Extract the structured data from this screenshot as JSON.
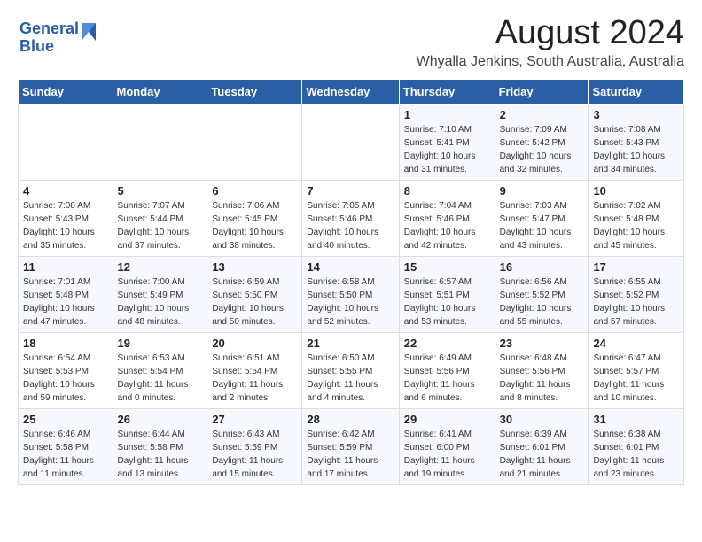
{
  "header": {
    "logo_line1": "General",
    "logo_line2": "Blue",
    "title": "August 2024",
    "subtitle": "Whyalla Jenkins, South Australia, Australia"
  },
  "days_of_week": [
    "Sunday",
    "Monday",
    "Tuesday",
    "Wednesday",
    "Thursday",
    "Friday",
    "Saturday"
  ],
  "weeks": [
    [
      {
        "day": "",
        "info": ""
      },
      {
        "day": "",
        "info": ""
      },
      {
        "day": "",
        "info": ""
      },
      {
        "day": "",
        "info": ""
      },
      {
        "day": "1",
        "info": "Sunrise: 7:10 AM\nSunset: 5:41 PM\nDaylight: 10 hours\nand 31 minutes."
      },
      {
        "day": "2",
        "info": "Sunrise: 7:09 AM\nSunset: 5:42 PM\nDaylight: 10 hours\nand 32 minutes."
      },
      {
        "day": "3",
        "info": "Sunrise: 7:08 AM\nSunset: 5:43 PM\nDaylight: 10 hours\nand 34 minutes."
      }
    ],
    [
      {
        "day": "4",
        "info": "Sunrise: 7:08 AM\nSunset: 5:43 PM\nDaylight: 10 hours\nand 35 minutes."
      },
      {
        "day": "5",
        "info": "Sunrise: 7:07 AM\nSunset: 5:44 PM\nDaylight: 10 hours\nand 37 minutes."
      },
      {
        "day": "6",
        "info": "Sunrise: 7:06 AM\nSunset: 5:45 PM\nDaylight: 10 hours\nand 38 minutes."
      },
      {
        "day": "7",
        "info": "Sunrise: 7:05 AM\nSunset: 5:46 PM\nDaylight: 10 hours\nand 40 minutes."
      },
      {
        "day": "8",
        "info": "Sunrise: 7:04 AM\nSunset: 5:46 PM\nDaylight: 10 hours\nand 42 minutes."
      },
      {
        "day": "9",
        "info": "Sunrise: 7:03 AM\nSunset: 5:47 PM\nDaylight: 10 hours\nand 43 minutes."
      },
      {
        "day": "10",
        "info": "Sunrise: 7:02 AM\nSunset: 5:48 PM\nDaylight: 10 hours\nand 45 minutes."
      }
    ],
    [
      {
        "day": "11",
        "info": "Sunrise: 7:01 AM\nSunset: 5:48 PM\nDaylight: 10 hours\nand 47 minutes."
      },
      {
        "day": "12",
        "info": "Sunrise: 7:00 AM\nSunset: 5:49 PM\nDaylight: 10 hours\nand 48 minutes."
      },
      {
        "day": "13",
        "info": "Sunrise: 6:59 AM\nSunset: 5:50 PM\nDaylight: 10 hours\nand 50 minutes."
      },
      {
        "day": "14",
        "info": "Sunrise: 6:58 AM\nSunset: 5:50 PM\nDaylight: 10 hours\nand 52 minutes."
      },
      {
        "day": "15",
        "info": "Sunrise: 6:57 AM\nSunset: 5:51 PM\nDaylight: 10 hours\nand 53 minutes."
      },
      {
        "day": "16",
        "info": "Sunrise: 6:56 AM\nSunset: 5:52 PM\nDaylight: 10 hours\nand 55 minutes."
      },
      {
        "day": "17",
        "info": "Sunrise: 6:55 AM\nSunset: 5:52 PM\nDaylight: 10 hours\nand 57 minutes."
      }
    ],
    [
      {
        "day": "18",
        "info": "Sunrise: 6:54 AM\nSunset: 5:53 PM\nDaylight: 10 hours\nand 59 minutes."
      },
      {
        "day": "19",
        "info": "Sunrise: 6:53 AM\nSunset: 5:54 PM\nDaylight: 11 hours\nand 0 minutes."
      },
      {
        "day": "20",
        "info": "Sunrise: 6:51 AM\nSunset: 5:54 PM\nDaylight: 11 hours\nand 2 minutes."
      },
      {
        "day": "21",
        "info": "Sunrise: 6:50 AM\nSunset: 5:55 PM\nDaylight: 11 hours\nand 4 minutes."
      },
      {
        "day": "22",
        "info": "Sunrise: 6:49 AM\nSunset: 5:56 PM\nDaylight: 11 hours\nand 6 minutes."
      },
      {
        "day": "23",
        "info": "Sunrise: 6:48 AM\nSunset: 5:56 PM\nDaylight: 11 hours\nand 8 minutes."
      },
      {
        "day": "24",
        "info": "Sunrise: 6:47 AM\nSunset: 5:57 PM\nDaylight: 11 hours\nand 10 minutes."
      }
    ],
    [
      {
        "day": "25",
        "info": "Sunrise: 6:46 AM\nSunset: 5:58 PM\nDaylight: 11 hours\nand 11 minutes."
      },
      {
        "day": "26",
        "info": "Sunrise: 6:44 AM\nSunset: 5:58 PM\nDaylight: 11 hours\nand 13 minutes."
      },
      {
        "day": "27",
        "info": "Sunrise: 6:43 AM\nSunset: 5:59 PM\nDaylight: 11 hours\nand 15 minutes."
      },
      {
        "day": "28",
        "info": "Sunrise: 6:42 AM\nSunset: 5:59 PM\nDaylight: 11 hours\nand 17 minutes."
      },
      {
        "day": "29",
        "info": "Sunrise: 6:41 AM\nSunset: 6:00 PM\nDaylight: 11 hours\nand 19 minutes."
      },
      {
        "day": "30",
        "info": "Sunrise: 6:39 AM\nSunset: 6:01 PM\nDaylight: 11 hours\nand 21 minutes."
      },
      {
        "day": "31",
        "info": "Sunrise: 6:38 AM\nSunset: 6:01 PM\nDaylight: 11 hours\nand 23 minutes."
      }
    ]
  ]
}
